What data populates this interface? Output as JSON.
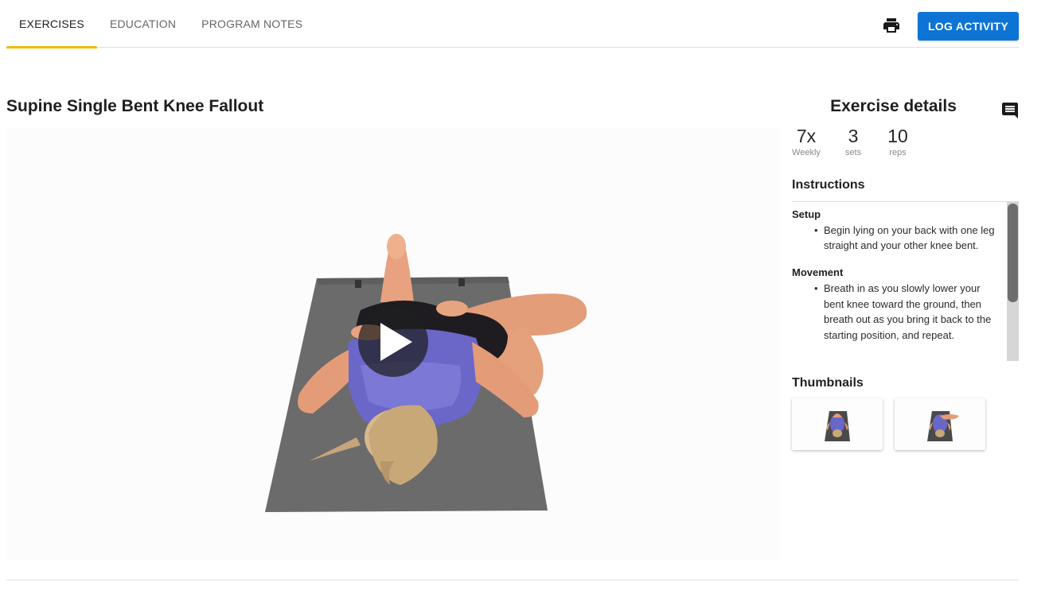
{
  "tabs": [
    {
      "label": "EXERCISES",
      "active": true
    },
    {
      "label": "EDUCATION",
      "active": false
    },
    {
      "label": "PROGRAM NOTES",
      "active": false
    }
  ],
  "toolbar": {
    "print_icon": "printer-icon",
    "log_label": "LOG ACTIVITY",
    "log_color": "#0d74d5"
  },
  "exercise": {
    "title": "Supine Single Bent Knee Fallout",
    "video_icon": "play-icon"
  },
  "details": {
    "title": "Exercise details",
    "comment_icon": "comment-icon",
    "stats": [
      {
        "value": "7x",
        "unit": "Weekly"
      },
      {
        "value": "3",
        "unit": "sets"
      },
      {
        "value": "10",
        "unit": "reps"
      }
    ]
  },
  "instructions": {
    "heading": "Instructions",
    "sections": [
      {
        "title": "Setup",
        "text": "Begin lying on your back with one leg straight and your other knee bent."
      },
      {
        "title": "Movement",
        "text": "Breath in as you slowly lower your bent knee toward the ground, then breath out as you bring it back to the starting position, and repeat."
      }
    ]
  },
  "thumbnails": {
    "heading": "Thumbnails",
    "count": 2
  },
  "colors": {
    "accent_tab": "#f5b800",
    "primary": "#0d74d5"
  }
}
